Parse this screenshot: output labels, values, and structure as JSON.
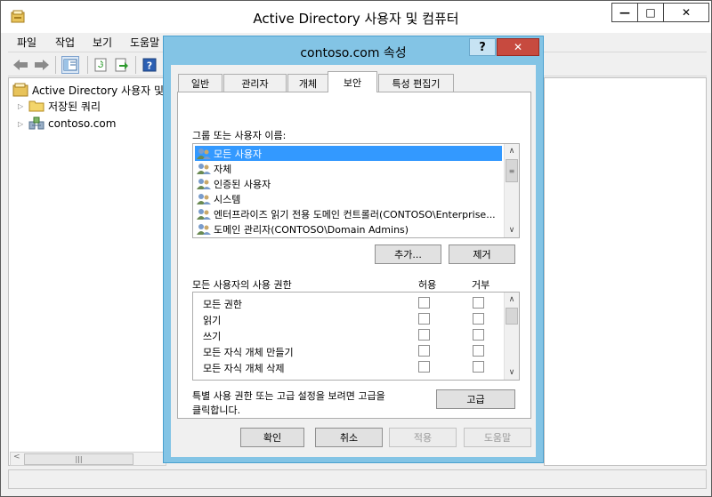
{
  "app": {
    "title": "Active Directory 사용자 및 컴퓨터",
    "window_buttons": {
      "minimize": "—",
      "maximize": "□",
      "close": "✕"
    }
  },
  "menubar": [
    "파일",
    "작업",
    "보기",
    "도움말"
  ],
  "toolbar": {
    "icons": [
      "back-arrow-icon",
      "forward-arrow-icon",
      "console-tree-icon",
      "refresh-icon",
      "export-list-icon",
      "help-icon"
    ]
  },
  "tree": {
    "root": "Active Directory 사용자 및 컴퓨터",
    "items": [
      {
        "label": "저장된 쿼리",
        "icon": "folder-icon"
      },
      {
        "label": "contoso.com",
        "icon": "domain-icon"
      }
    ]
  },
  "dialog": {
    "title": "contoso.com 속성",
    "help_label": "?",
    "close_label": "✕",
    "tabs": [
      {
        "label": "일반",
        "active": false
      },
      {
        "label": "관리자",
        "active": false
      },
      {
        "label": "개체",
        "active": false
      },
      {
        "label": "보안",
        "active": true
      },
      {
        "label": "특성 편집기",
        "active": false
      }
    ],
    "principals_label": "그룹 또는 사용자 이름:",
    "principals": [
      {
        "label": "모든 사용자",
        "selected": true
      },
      {
        "label": "자체",
        "selected": false
      },
      {
        "label": "인증된 사용자",
        "selected": false
      },
      {
        "label": "시스템",
        "selected": false
      },
      {
        "label": "엔터프라이즈 읽기 전용 도메인 컨트롤러(CONTOSO\\Enterprise...",
        "selected": false
      },
      {
        "label": "도메인 관리자(CONTOSO\\Domain Admins)",
        "selected": false
      }
    ],
    "add_button": "추가...",
    "remove_button": "제거",
    "permissions_label": "모든 사용자의 사용 권한",
    "allow_header": "허용",
    "deny_header": "거부",
    "permissions": [
      {
        "name": "모든 권한",
        "allow": false,
        "deny": false
      },
      {
        "name": "읽기",
        "allow": false,
        "deny": false
      },
      {
        "name": "쓰기",
        "allow": false,
        "deny": false
      },
      {
        "name": "모든 자식 개체 만들기",
        "allow": false,
        "deny": false
      },
      {
        "name": "모든 자식 개체 삭제",
        "allow": false,
        "deny": false
      }
    ],
    "advanced_text_line1": "특별 사용 권한 또는 고급 설정을 보려면 고급을",
    "advanced_text_line2": "클릭합니다.",
    "advanced_button": "고급",
    "ok_button": "확인",
    "cancel_button": "취소",
    "apply_button": "적용",
    "help_button": "도움말"
  },
  "colors": {
    "dialog_frame": "#83c4e5",
    "selection": "#3399ff",
    "close_button": "#c74a3f"
  }
}
